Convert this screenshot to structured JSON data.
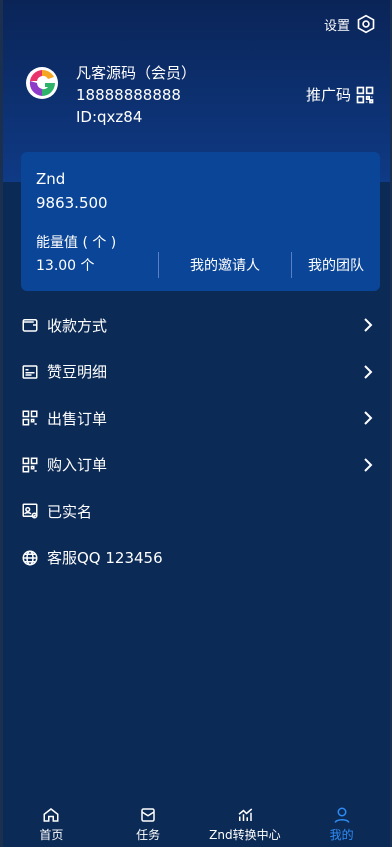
{
  "header": {
    "settings_label": "设置",
    "user_name": "凡客源码（会员）",
    "phone": "18888888888",
    "user_id": "ID:qxz84",
    "promo_label": "推广码"
  },
  "card": {
    "coin_name": "Znd",
    "coin_value": "9863.500",
    "energy_label": "能量值 ( 个 )",
    "energy_value": "13.00 个",
    "inviter_label": "我的邀请人",
    "team_label": "我的团队"
  },
  "menu": [
    {
      "label": "收款方式",
      "icon": "wallet-icon",
      "chevron": true
    },
    {
      "label": "赞豆明细",
      "icon": "card-list-icon",
      "chevron": true
    },
    {
      "label": "出售订单",
      "icon": "grid-icon",
      "chevron": true
    },
    {
      "label": "购入订单",
      "icon": "grid-icon",
      "chevron": true
    },
    {
      "label": "已实名",
      "icon": "id-verified-icon",
      "chevron": false
    },
    {
      "label": "客服QQ 123456",
      "icon": "globe-icon",
      "chevron": false
    }
  ],
  "tabs": [
    {
      "label": "首页",
      "icon": "home-icon",
      "active": false
    },
    {
      "label": "任务",
      "icon": "task-icon",
      "active": false
    },
    {
      "label": "Znd转换中心",
      "icon": "chart-icon",
      "active": false
    },
    {
      "label": "我的",
      "icon": "user-icon",
      "active": true
    }
  ],
  "colors": {
    "background": "#0b2a56",
    "card": "#0b4597",
    "active_tab": "#2f8cf5"
  }
}
